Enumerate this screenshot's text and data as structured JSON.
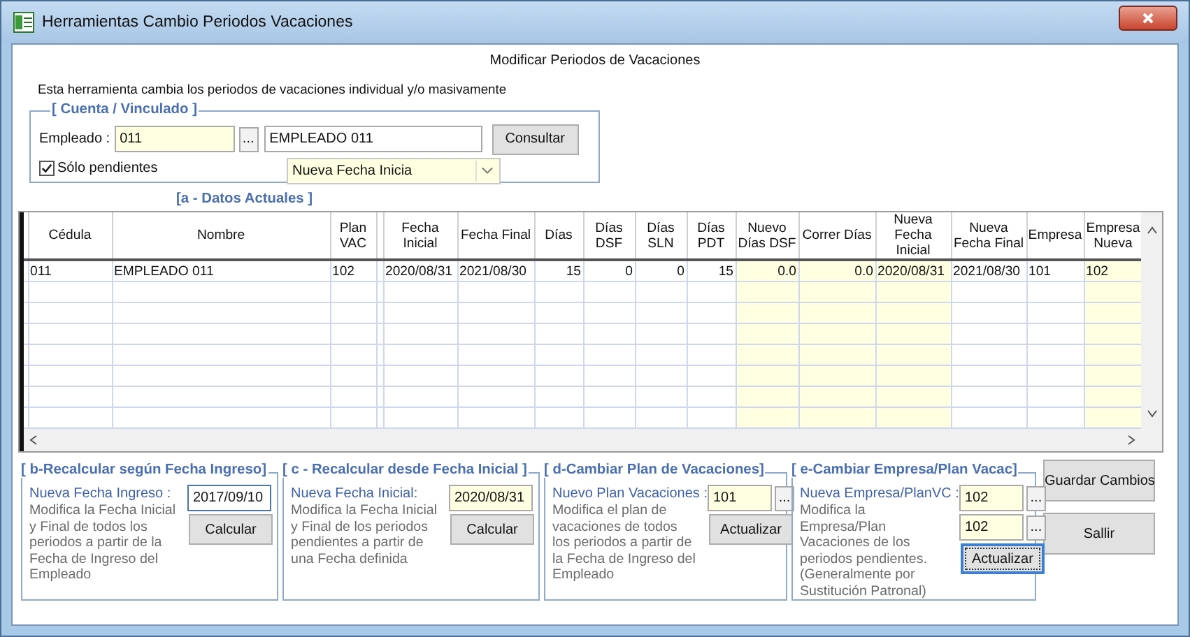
{
  "window": {
    "title": "Herramientas Cambio Periodos Vacaciones"
  },
  "header": {
    "title": "Modificar Periodos de Vacaciones",
    "description": "Esta herramienta cambia los periodos de vacaciones individual y/o masivamente"
  },
  "cuenta": {
    "legend": "[ Cuenta / Vinculado ]",
    "employee_label": "Empleado :",
    "employee_code": "011",
    "lookup_button": "...",
    "employee_name": "EMPLEADO 011",
    "consult_button": "Consultar",
    "only_pending": {
      "label": "Sólo pendientes",
      "checked": true
    },
    "mode_select": "Nueva Fecha Inicia"
  },
  "datos": {
    "legend": "[a - Datos Actuales ]",
    "columns": [
      {
        "editable": false
      },
      {
        "label": "Cédula",
        "right_aligned": false,
        "editable": false
      },
      {
        "label": "Nombre",
        "right_aligned": false,
        "editable": false
      },
      {
        "label": "Plan VAC",
        "right_aligned": false,
        "editable": false
      },
      {
        "editable": false
      },
      {
        "label": "Fecha Inicial",
        "right_aligned": false,
        "editable": false
      },
      {
        "label": "Fecha Final",
        "right_aligned": false,
        "editable": false
      },
      {
        "label": "Días",
        "right_aligned": true,
        "editable": false
      },
      {
        "label": "Días DSF",
        "right_aligned": true,
        "editable": false
      },
      {
        "label": "Días SLN",
        "right_aligned": true,
        "editable": false
      },
      {
        "label": "Días PDT",
        "right_aligned": true,
        "editable": false
      },
      {
        "label": "Nuevo Días DSF",
        "right_aligned": true,
        "editable": true
      },
      {
        "label": "Correr Días",
        "right_aligned": true,
        "editable": true
      },
      {
        "label": "Nueva Fecha Inicial",
        "right_aligned": false,
        "editable": true
      },
      {
        "label": "Nueva Fecha Final",
        "right_aligned": false,
        "editable": false
      },
      {
        "label": "Empresa",
        "right_aligned": false,
        "editable": false
      },
      {
        "label": "Empresa Nueva",
        "right_aligned": false,
        "editable": true
      }
    ],
    "rows": [
      [
        "",
        "011",
        "EMPLEADO 011",
        "102",
        "",
        "2020/08/31",
        "2021/08/30",
        "15",
        "0",
        "0",
        "15",
        "0.0",
        "0.0",
        "2020/08/31",
        "2021/08/30",
        "101",
        "102"
      ]
    ]
  },
  "sections": [
    {
      "legend": "[ b-Recalcular según Fecha Ingreso]",
      "field_label": "Nueva Fecha Ingreso :",
      "description": "Modifica la Fecha Inicial y Final de todos los periodos a partir de la Fecha de Ingreso del Empleado",
      "fields": [
        {
          "value": "2017/09/10",
          "highlighted": false
        }
      ],
      "button": {
        "label": "Calcular",
        "focused": false
      }
    },
    {
      "legend": "[ c - Recalcular desde Fecha Inicial ]",
      "field_label": "Nueva Fecha Inicial:",
      "description": "Modifica la Fecha Inicial y Final de los periodos pendientes a partir de una Fecha definida",
      "fields": [
        {
          "value": "2020/08/31",
          "highlighted": true
        }
      ],
      "button": {
        "label": "Calcular",
        "focused": false
      }
    },
    {
      "legend": "[ d-Cambiar Plan de Vacaciones]",
      "field_label": "Nuevo Plan Vacaciones :",
      "description": "Modifica el plan de vacaciones de todos los periodos a partir de la Fecha de Ingreso del Empleado",
      "fields": [
        {
          "value": "101",
          "highlighted": true,
          "lookup": "..."
        }
      ],
      "button": {
        "label": "Actualizar",
        "focused": false
      }
    },
    {
      "legend": "[ e-Cambiar Empresa/Plan Vacac]",
      "field_label": "Nueva Empresa/PlanVC :",
      "description": "Modifica la Empresa/Plan Vacaciones de los periodos pendientes. (Generalmente por Sustitución Patronal)",
      "fields": [
        {
          "value": "102",
          "highlighted": true,
          "lookup": "..."
        },
        {
          "value": "102",
          "highlighted": true,
          "lookup": "..."
        }
      ],
      "button": {
        "label": "Actualizar",
        "focused": true
      }
    }
  ],
  "buttons": [
    {
      "label": "Guardar Cambios"
    },
    {
      "label": "Sallir"
    }
  ]
}
